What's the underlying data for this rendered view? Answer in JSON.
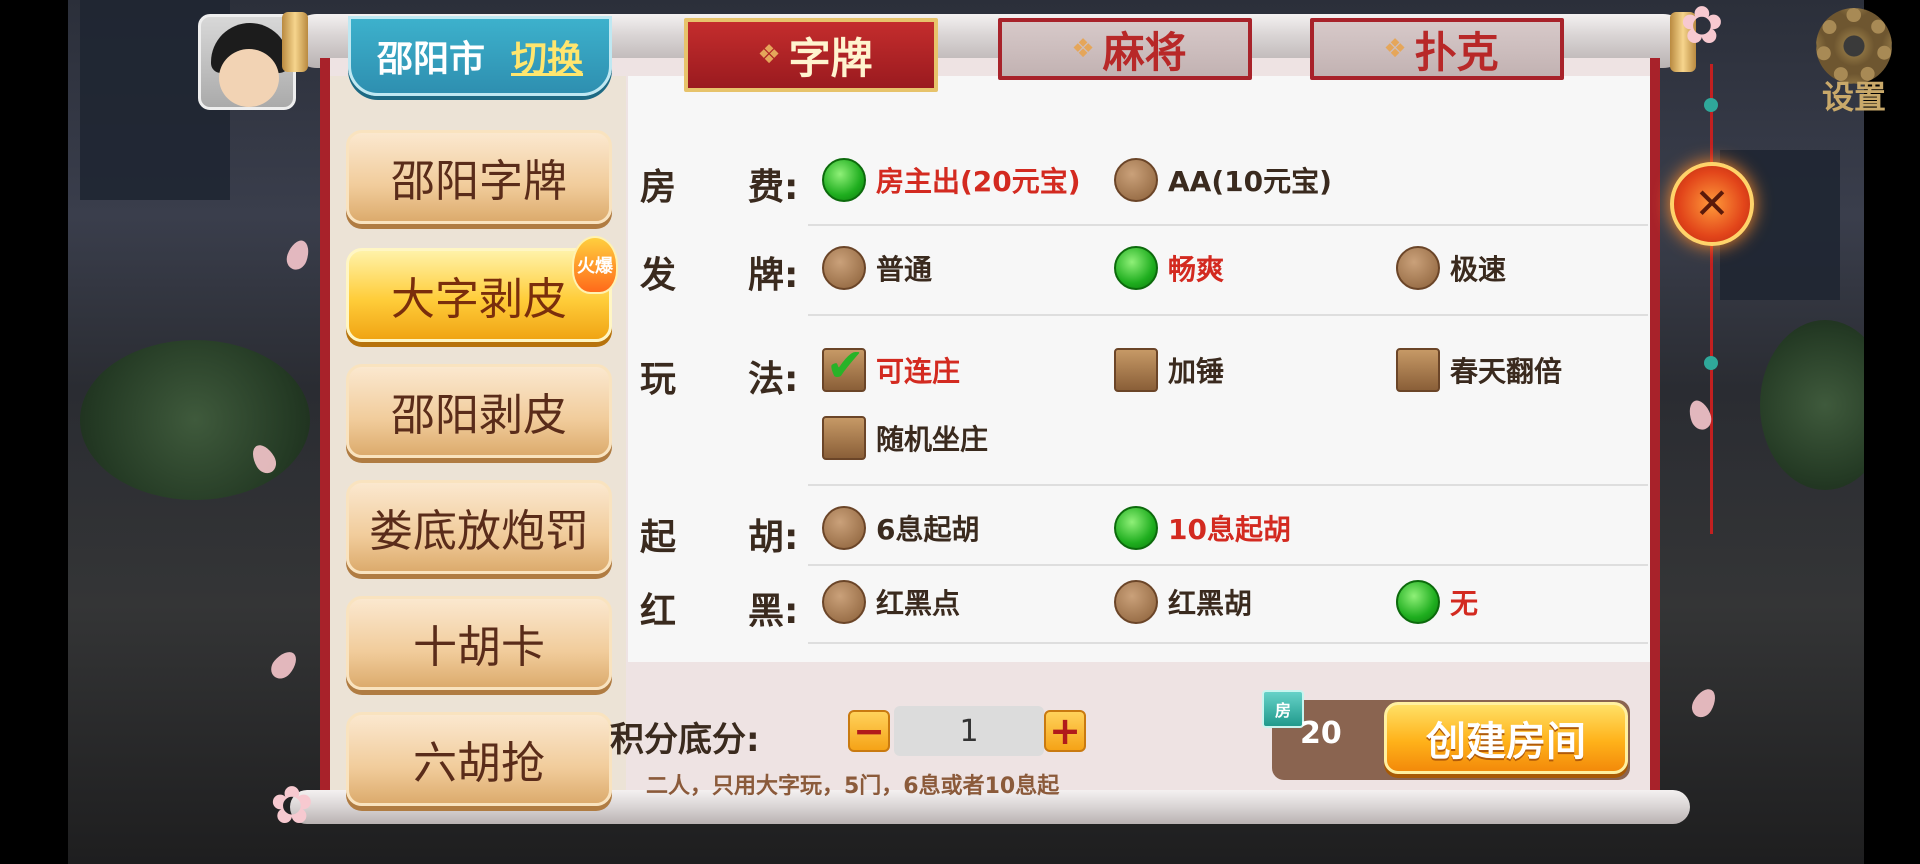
{
  "city": {
    "name": "邵阳市",
    "switch_label": "切换"
  },
  "tabs": [
    {
      "label": "字牌",
      "active": true
    },
    {
      "label": "麻将",
      "active": false
    },
    {
      "label": "扑克",
      "active": false
    }
  ],
  "settings_label": "设置",
  "games": [
    {
      "label": "邵阳字牌",
      "active": false
    },
    {
      "label": "大字剥皮",
      "active": true,
      "badge": "火爆"
    },
    {
      "label": "邵阳剥皮",
      "active": false
    },
    {
      "label": "娄底放炮罚",
      "active": false
    },
    {
      "label": "十胡卡",
      "active": false
    },
    {
      "label": "六胡抢",
      "active": false
    }
  ],
  "rules": {
    "room_fee": {
      "label": [
        "房",
        "费:"
      ],
      "options": [
        {
          "text": "房主出(20元宝)",
          "selected": true
        },
        {
          "text": "AA(10元宝)",
          "selected": false
        }
      ]
    },
    "deal": {
      "label": [
        "发",
        "牌:"
      ],
      "options": [
        {
          "text": "普通",
          "selected": false
        },
        {
          "text": "畅爽",
          "selected": true
        },
        {
          "text": "极速",
          "selected": false
        }
      ]
    },
    "play": {
      "label": [
        "玩",
        "法:"
      ],
      "options": [
        {
          "text": "可连庄",
          "selected": true
        },
        {
          "text": "加锤",
          "selected": false
        },
        {
          "text": "春天翻倍",
          "selected": false
        },
        {
          "text": "随机坐庄",
          "selected": false
        }
      ]
    },
    "start_hu": {
      "label": [
        "起",
        "胡:"
      ],
      "options": [
        {
          "text": "6息起胡",
          "selected": false
        },
        {
          "text": "10息起胡",
          "selected": true
        }
      ]
    },
    "red_black": {
      "label": [
        "红",
        "黑:"
      ],
      "options": [
        {
          "text": "红黑点",
          "selected": false
        },
        {
          "text": "红黑胡",
          "selected": false
        },
        {
          "text": "无",
          "selected": true
        }
      ]
    }
  },
  "score": {
    "label": "积分底分:",
    "value": "1",
    "minus": "−",
    "plus": "+"
  },
  "description": "二人，只用大字玩，5门，6息或者10息起",
  "create": {
    "ticket": "房",
    "cost": "20",
    "label": "创建房间"
  },
  "close_symbol": "✕",
  "colors": {
    "selected_text": "#d32a20",
    "panel_red": "#a8222a",
    "create_orange": "#ffb21a"
  }
}
